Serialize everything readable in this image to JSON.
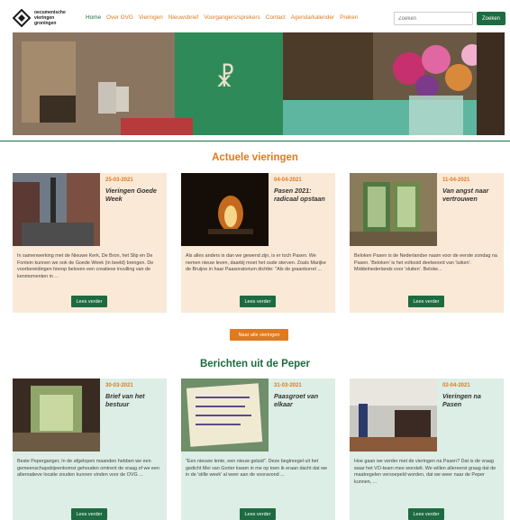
{
  "header": {
    "logo_lines": [
      "oecumenische",
      "vieringen",
      "groningen"
    ],
    "nav": [
      "Home",
      "Over OVG",
      "Vieringen",
      "Nieuwsbrief",
      "Voorgangers/sprekers",
      "Contact",
      "Agenda/kalender",
      "Preken"
    ],
    "search_placeholder": "Zoeken",
    "search_button": "Zoeken"
  },
  "sections": {
    "vieringen_title": "Actuele vieringen",
    "berichten_title": "Berichten uit de Peper",
    "all_vieringen_button": "Naar alle vieringen"
  },
  "vieringen": [
    {
      "date": "25-03-2021",
      "title": "Vieringen Goede Week",
      "text": "In samenwerking met de Nieuwe Kerk, De Bron, het Slip en De Fontein kunnen we ook de Goede Week (in beeld) brengen. De voorbereidingen hierop beloven een creatieve invulling van de kenmomenten in ...",
      "button": "Lees verder"
    },
    {
      "date": "04-04-2021",
      "title": "Pasen 2021: radicaal opstaan",
      "text": "Als alles anders is dan we gewend zijn, is er toch Pasen. We nemen nieuw leven, daarbij moet het oude sterven. Zoals Marijke de Bruijne in haar Paasoratorium dichtte: \"Als de graankorrel ...",
      "button": "Lees verder"
    },
    {
      "date": "11-04-2021",
      "title": "Van angst naar vertrouwen",
      "text": "Beloken Pasen is de Nederlandse naam voor de eerste zondag na Pasen. 'Beloken' is het voltooid deelwoord van 'luiken'. Middelnederlands voor 'sluiten'. Beloke...",
      "button": "Lees verder"
    }
  ],
  "berichten": [
    {
      "date": "30-03-2021",
      "title": "Brief van het bestuur",
      "text": "Beste Peperganger, In de afgelopen maanden hebben we een gemeenschapsbijeenkomst gehouden omtrent de vraag of we een alternatieve locatie zouden kunnen vinden voor de OVG ...",
      "button": "Lees verder"
    },
    {
      "date": "31-03-2021",
      "title": "Paasgroet van elkaar",
      "text": "\"Een nieuwe lente, een nieuw geluid\". Deze beginregel uit het gedicht Mei van Gorter kwam in me op toen ik eraan dacht dat we in de 'stille week' al weer aan de vooravond ...",
      "button": "Lees verder"
    },
    {
      "date": "02-04-2021",
      "title": "Vieringen na Pasen",
      "text": "Hoe gaan we verder met de vieringen na Pasen? Dat is de vraag waar het VO-team mee worstelt. We willen allereerst graag dat de maatregelen versoepeld worden, dat we weer naar de Peper kunnen, ...",
      "button": "Lees verder"
    }
  ],
  "colors": {
    "accent": "#e07a1f",
    "brand": "#1d6b40",
    "card_peach": "#fbe9d7",
    "card_teal": "#dceee6"
  }
}
